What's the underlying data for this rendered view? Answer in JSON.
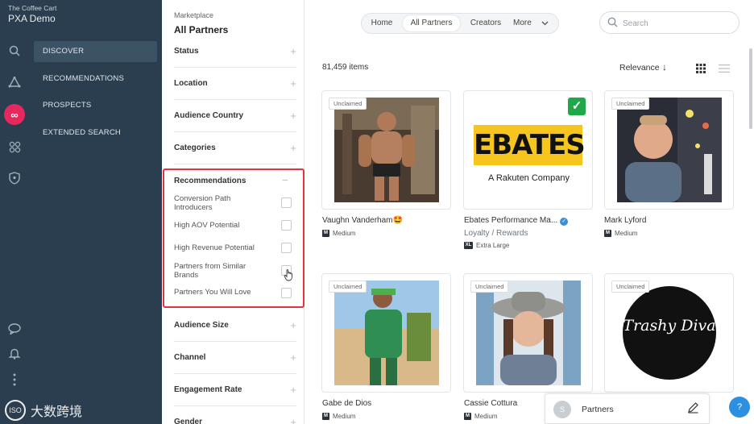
{
  "brand": {
    "org": "The Coffee Cart",
    "name": "PXA Demo"
  },
  "rail_icons": [
    "search-icon",
    "network-icon",
    "infinity-icon",
    "molecule-icon",
    "shield-icon",
    "chat-icon",
    "bell-icon",
    "more-dots-icon"
  ],
  "nav": {
    "items": [
      {
        "label": "DISCOVER",
        "active": true
      },
      {
        "label": "RECOMMENDATIONS",
        "active": false
      },
      {
        "label": "PROSPECTS",
        "active": false
      },
      {
        "label": "EXTENDED SEARCH",
        "active": false
      }
    ]
  },
  "breadcrumb": {
    "section": "Marketplace",
    "title": "All Partners"
  },
  "filters": {
    "items": [
      "Status",
      "Location",
      "Audience Country",
      "Categories",
      "Audience Size",
      "Channel",
      "Engagement Rate",
      "Gender"
    ],
    "recommendations": {
      "title": "Recommendations",
      "options": [
        "Conversion Path Introducers",
        "High AOV Potential",
        "High Revenue Potential",
        "Partners from Similar Brands",
        "Partners You Will Love"
      ]
    }
  },
  "topnav": {
    "tabs": [
      "Home",
      "All Partners",
      "Creators",
      "More"
    ],
    "active": "All Partners"
  },
  "search": {
    "placeholder": "Search",
    "value": ""
  },
  "results": {
    "count": "81,459 items",
    "sort": "Relevance"
  },
  "cards": [
    {
      "tag": "Unclaimed",
      "name": "Vaughn Vanderham🤩",
      "sub": "",
      "size_code": "M",
      "size": "Medium",
      "verified": false,
      "claimed": false
    },
    {
      "tag": "",
      "name": "Ebates Performance Ma...",
      "sub": "Loyalty / Rewards",
      "size_code": "XL",
      "size": "Extra Large",
      "verified": true,
      "claimed": true,
      "logo_text": "EBATES",
      "logo_sub": "A Rakuten Company"
    },
    {
      "tag": "Unclaimed",
      "name": "Mark Lyford",
      "sub": "",
      "size_code": "M",
      "size": "Medium",
      "verified": false,
      "claimed": false
    },
    {
      "tag": "Unclaimed",
      "name": "Gabe de Dios",
      "sub": "",
      "size_code": "M",
      "size": "Medium",
      "verified": false,
      "claimed": false
    },
    {
      "tag": "Unclaimed",
      "name": "Cassie Cottura",
      "sub": "",
      "size_code": "M",
      "size": "Medium",
      "verified": false,
      "claimed": false
    },
    {
      "tag": "Unclaimed",
      "name": "",
      "sub": "",
      "size_code": "",
      "size": "",
      "verified": false,
      "claimed": false,
      "logo_text": "Trashy Diva"
    }
  ],
  "partners_bar": {
    "avatar": "S",
    "label": "Partners"
  },
  "help": "?",
  "watermark": {
    "logo": "ISO",
    "text": "大数跨境"
  },
  "colors": {
    "sidebar": "#2b3e4f",
    "accent": "#e5285d",
    "highlight": "#e5323f",
    "claimed": "#1fa74a",
    "verified": "#3b8fd9"
  }
}
